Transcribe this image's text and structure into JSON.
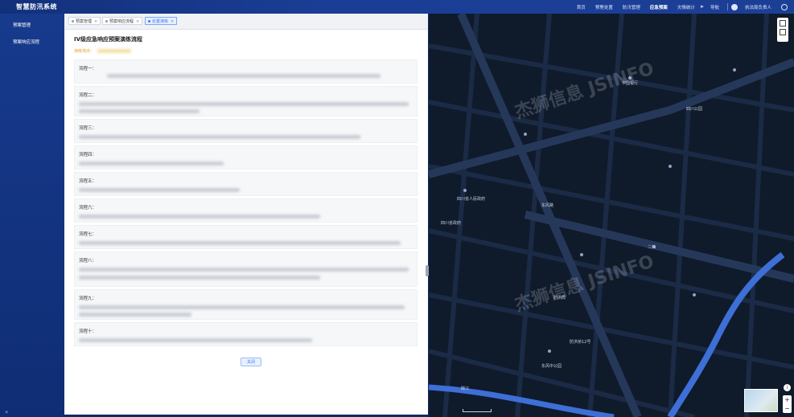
{
  "app": {
    "title": "智慧防汛系统"
  },
  "nav": {
    "items": [
      "首页",
      "预警处置",
      "防汛管理",
      "应急预案",
      "灾情统计"
    ],
    "active_index": 3,
    "nav_label": "导航",
    "user_label": "执法局负责人"
  },
  "sidebar": {
    "items": [
      "预案管理",
      "预案响应流程"
    ]
  },
  "tabs": [
    {
      "label": "预案管理",
      "active": false
    },
    {
      "label": "预案响应流程",
      "active": false
    },
    {
      "label": "处置演练",
      "active": true
    }
  ],
  "detail": {
    "title": "IV级应急响应预案演练流程",
    "subtitle_label": "演练地点：",
    "steps": [
      {
        "label": "流程一："
      },
      {
        "label": "流程二："
      },
      {
        "label": "流程三："
      },
      {
        "label": "流程四："
      },
      {
        "label": "流程五："
      },
      {
        "label": "流程六："
      },
      {
        "label": "流程七："
      },
      {
        "label": "流程八："
      },
      {
        "label": "流程九："
      },
      {
        "label": "流程十："
      }
    ],
    "close_label": "关闭"
  },
  "map": {
    "labels": [
      "四川省人民政府",
      "四川省政府",
      "东风路",
      "二仙",
      "防汛局",
      "防洪桥12号",
      "东风中公园",
      "跨江",
      "中国银行",
      "四川公园"
    ],
    "watermark": "杰狮信息 JSINFO",
    "controls": [
      "layers-icon",
      "basemap-icon",
      "zoom-in-icon",
      "zoom-out-icon",
      "info-icon"
    ]
  },
  "colors": {
    "brand": "#1a3d95",
    "accent": "#3b7df0",
    "map_bg": "#0f1a2b",
    "river": "#3d6fd6"
  }
}
